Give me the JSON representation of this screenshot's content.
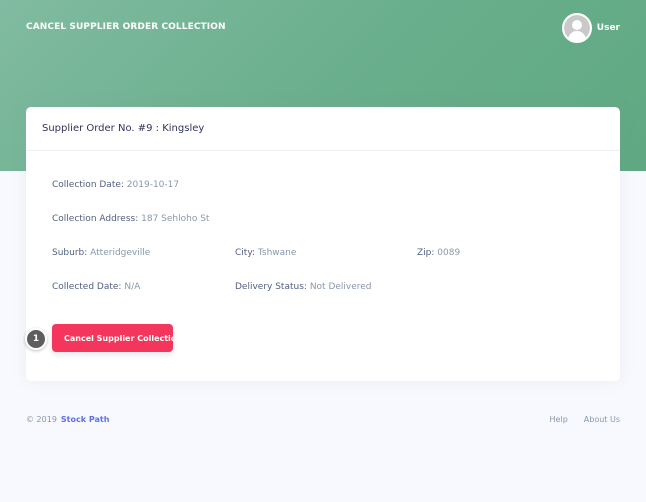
{
  "header": {
    "title": "CANCEL SUPPLIER ORDER COLLECTION",
    "user_name": "User",
    "avatar_icon": "user-avatar-icon"
  },
  "card": {
    "title": "Supplier Order No. #9 : Kingsley",
    "collection_date_label": "Collection Date:",
    "collection_date_value": "2019-10-17",
    "collection_address_label": "Collection Address:",
    "collection_address_value": "187 Sehloho St",
    "suburb_label": "Suburb:",
    "suburb_value": "Atteridgeville",
    "city_label": "City:",
    "city_value": "Tshwane",
    "zip_label": "Zip:",
    "zip_value": "0089",
    "collected_date_label": "Collected Date:",
    "collected_date_value": "N/A",
    "delivery_status_label": "Delivery Status:",
    "delivery_status_value": "Not Delivered",
    "cancel_button_label": "Cancel Supplier Collection",
    "step_badge": "1"
  },
  "footer": {
    "copyright": "© 2019",
    "brand": "Stock Path",
    "links": [
      "Help",
      "About Us"
    ]
  },
  "colors": {
    "header_gradient_start": "#81bba0",
    "header_gradient_end": "#5fa882",
    "danger": "#f5365c",
    "brand_link": "#5e72e4"
  }
}
